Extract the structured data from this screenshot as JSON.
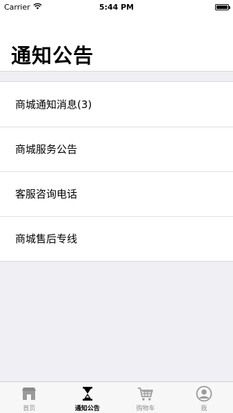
{
  "status_bar": {
    "carrier": "Carrier",
    "time": "5:44 PM",
    "battery_level": 1.0
  },
  "header": {
    "title": "通知公告"
  },
  "list": {
    "items": [
      {
        "label": "商城通知消息(3)"
      },
      {
        "label": "商城服务公告"
      },
      {
        "label": "客服咨询电话"
      },
      {
        "label": "商城售后专线"
      }
    ]
  },
  "tab_bar": {
    "active_index": 1,
    "tabs": [
      {
        "label": "首页",
        "icon": "store-icon"
      },
      {
        "label": "通知公告",
        "icon": "hourglass-icon"
      },
      {
        "label": "购物车",
        "icon": "cart-icon"
      },
      {
        "label": "我",
        "icon": "user-icon"
      }
    ]
  },
  "colors": {
    "background": "#efeff4",
    "active_tab": "#000000",
    "inactive_tab": "#8e8e8e"
  }
}
